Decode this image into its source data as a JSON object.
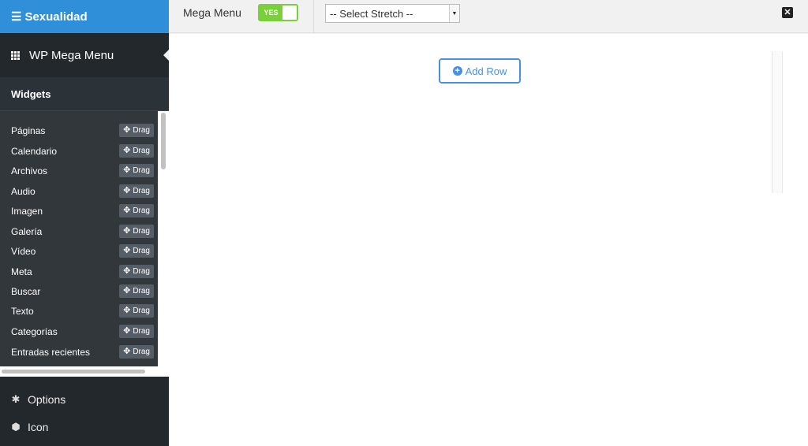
{
  "menu": {
    "title": "Sexualidad"
  },
  "panel": {
    "title": "WP Mega Menu"
  },
  "widgets": {
    "heading": "Widgets",
    "drag_label": "Drag",
    "items": [
      "Páginas",
      "Calendario",
      "Archivos",
      "Audio",
      "Imagen",
      "Galería",
      "Vídeo",
      "Meta",
      "Buscar",
      "Texto",
      "Categorías",
      "Entradas recientes"
    ]
  },
  "nav": {
    "options": "Options",
    "icon": "Icon"
  },
  "topbar": {
    "mega_menu_label": "Mega Menu",
    "toggle_label": "YES",
    "toggle_state": true,
    "stretch_select": "-- Select Stretch --"
  },
  "main": {
    "add_row_label": "Add Row"
  },
  "colors": {
    "accent": "#4a90e2",
    "toggle": "#7ad03a",
    "header": "#2f8fd8",
    "sidebar": "#23282d"
  }
}
